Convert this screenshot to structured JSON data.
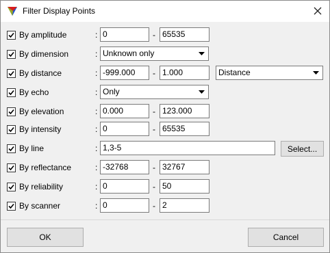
{
  "window": {
    "title": "Filter Display Points",
    "app_icon": "colored-triangle-icon",
    "close_icon": "close-icon"
  },
  "filters": [
    {
      "label": "By amplitude",
      "checked": true,
      "kind": "range",
      "from": "0",
      "to": "65535"
    },
    {
      "label": "By dimension",
      "checked": true,
      "kind": "combo",
      "value": "Unknown only"
    },
    {
      "label": "By distance",
      "checked": true,
      "kind": "range-combo",
      "from": "-999.000",
      "to": "1.000",
      "combo": "Distance"
    },
    {
      "label": "By echo",
      "checked": true,
      "kind": "combo",
      "value": "Only"
    },
    {
      "label": "By elevation",
      "checked": true,
      "kind": "range",
      "from": "0.000",
      "to": "123.000"
    },
    {
      "label": "By intensity",
      "checked": true,
      "kind": "range",
      "from": "0",
      "to": "65535"
    },
    {
      "label": "By line",
      "checked": true,
      "kind": "text-button",
      "value": "1,3-5",
      "button": "Select..."
    },
    {
      "label": "By reflectance",
      "checked": true,
      "kind": "range",
      "from": "-32768",
      "to": "32767"
    },
    {
      "label": "By reliability",
      "checked": true,
      "kind": "range",
      "from": "0",
      "to": "50"
    },
    {
      "label": "By scanner",
      "checked": true,
      "kind": "range",
      "from": "0",
      "to": "2"
    }
  ],
  "separator": ":",
  "range_dash": "-",
  "buttons": {
    "ok": "OK",
    "cancel": "Cancel"
  }
}
